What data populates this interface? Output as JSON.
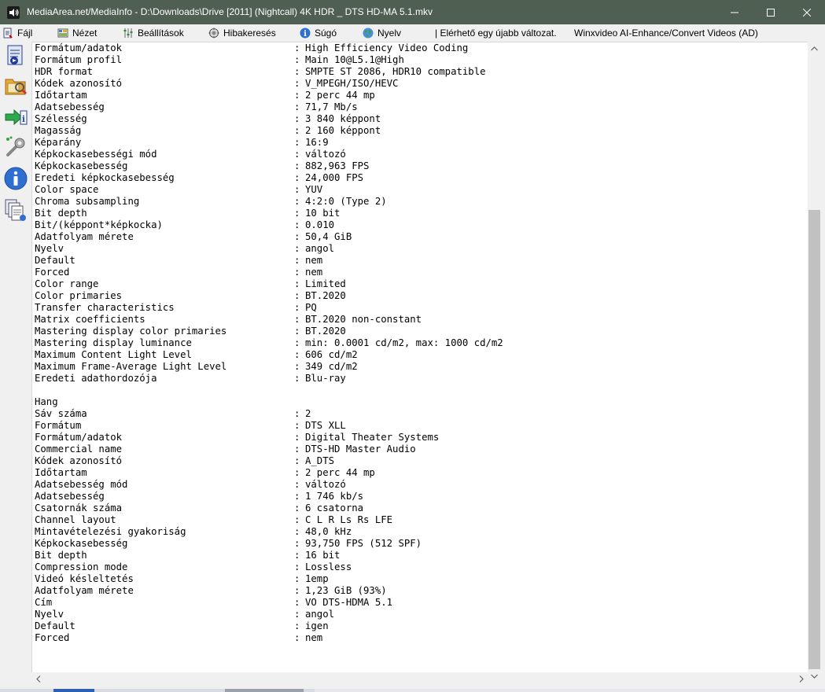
{
  "window": {
    "title": "MediaArea.net/MediaInfo - D:\\Downloads\\Drive [2011] (Nightcall) 4K HDR _ DTS HD-MA 5.1.mkv",
    "app_icon": "mediainfo-speaker-icon"
  },
  "menu": {
    "items": [
      {
        "label": "Fájl",
        "icon": "file-icon"
      },
      {
        "label": "Nézet",
        "icon": "view-icon"
      },
      {
        "label": "Beállítások",
        "icon": "preferences-icon"
      },
      {
        "label": "Hibakeresés",
        "icon": "debug-icon"
      },
      {
        "label": "Súgó",
        "icon": "help-icon"
      },
      {
        "label": "Nyelv",
        "icon": "language-globe-icon"
      }
    ],
    "update_notice": "| Elérhető egy újabb változat.",
    "ad_text": "Winxvideo AI-Enhance/Convert Videos (AD)"
  },
  "sidebar": {
    "buttons": [
      "open-file-icon",
      "open-folder-icon",
      "export-icon",
      "preferences-tools-icon",
      "about-info-icon",
      "sheet-view-icon"
    ]
  },
  "info": {
    "lines": [
      {
        "label": "Formátum/adatok",
        "value": "High Efficiency Video Coding"
      },
      {
        "label": "Formátum profil",
        "value": "Main 10@L5.1@High"
      },
      {
        "label": "HDR format",
        "value": "SMPTE ST 2086, HDR10 compatible"
      },
      {
        "label": "Kódek azonosító",
        "value": "V_MPEGH/ISO/HEVC"
      },
      {
        "label": "Időtartam",
        "value": "2 perc 44 mp"
      },
      {
        "label": "Adatsebesség",
        "value": "71,7 Mb/s"
      },
      {
        "label": "Szélesség",
        "value": "3 840 képpont"
      },
      {
        "label": "Magasság",
        "value": "2 160 képpont"
      },
      {
        "label": "Képarány",
        "value": "16:9"
      },
      {
        "label": "Képkockasebességi mód",
        "value": "változó"
      },
      {
        "label": "Képkockasebesség",
        "value": "882,963 FPS"
      },
      {
        "label": "Eredeti képkockasebesség",
        "value": "24,000 FPS"
      },
      {
        "label": "Color space",
        "value": "YUV"
      },
      {
        "label": "Chroma subsampling",
        "value": "4:2:0 (Type 2)"
      },
      {
        "label": "Bit depth",
        "value": "10 bit"
      },
      {
        "label": "Bit/(képpont*képkocka)",
        "value": "0.010"
      },
      {
        "label": "Adatfolyam mérete",
        "value": "50,4 GiB"
      },
      {
        "label": "Nyelv",
        "value": "angol"
      },
      {
        "label": "Default",
        "value": "nem"
      },
      {
        "label": "Forced",
        "value": "nem"
      },
      {
        "label": "Color range",
        "value": "Limited"
      },
      {
        "label": "Color primaries",
        "value": "BT.2020"
      },
      {
        "label": "Transfer characteristics",
        "value": "PQ"
      },
      {
        "label": "Matrix coefficients",
        "value": "BT.2020 non-constant"
      },
      {
        "label": "Mastering display color primaries",
        "value": "BT.2020"
      },
      {
        "label": "Mastering display luminance",
        "value": "min: 0.0001 cd/m2, max: 1000 cd/m2"
      },
      {
        "label": "Maximum Content Light Level",
        "value": "606 cd/m2"
      },
      {
        "label": "Maximum Frame-Average Light Level",
        "value": "349 cd/m2"
      },
      {
        "label": "Eredeti adathordozója",
        "value": "Blu-ray"
      },
      {
        "label": "",
        "value": ""
      },
      {
        "label": "Hang",
        "value": ""
      },
      {
        "label": "Sáv száma",
        "value": "2"
      },
      {
        "label": "Formátum",
        "value": "DTS XLL"
      },
      {
        "label": "Formátum/adatok",
        "value": "Digital Theater Systems"
      },
      {
        "label": "Commercial name",
        "value": "DTS-HD Master Audio"
      },
      {
        "label": "Kódek azonosító",
        "value": "A_DTS"
      },
      {
        "label": "Időtartam",
        "value": "2 perc 44 mp"
      },
      {
        "label": "Adatsebesség mód",
        "value": "változó"
      },
      {
        "label": "Adatsebesség",
        "value": "1 746 kb/s"
      },
      {
        "label": "Csatornák száma",
        "value": "6 csatorna"
      },
      {
        "label": "Channel layout",
        "value": "C L R Ls Rs LFE"
      },
      {
        "label": "Mintavételezési gyakoriság",
        "value": "48,0 kHz"
      },
      {
        "label": "Képkockasebesség",
        "value": "93,750 FPS (512 SPF)"
      },
      {
        "label": "Bit depth",
        "value": "16 bit"
      },
      {
        "label": "Compression mode",
        "value": "Lossless"
      },
      {
        "label": "Videó késleltetés",
        "value": "1emp"
      },
      {
        "label": "Adatfolyam mérete",
        "value": "1,23 GiB (93%)"
      },
      {
        "label": "Cím",
        "value": "VO DTS-HDMA 5.1"
      },
      {
        "label": "Nyelv",
        "value": "angol"
      },
      {
        "label": "Default",
        "value": "igen"
      },
      {
        "label": "Forced",
        "value": "nem"
      }
    ]
  },
  "colors": {
    "titlebar": "#4f5f52",
    "chrome": "#f0f0f0",
    "scroll_thumb": "#c1c1c1"
  }
}
